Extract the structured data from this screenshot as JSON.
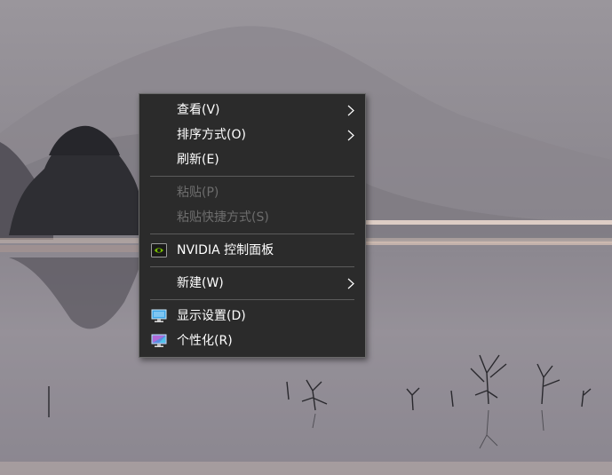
{
  "desktop": {
    "wallpaper": "misty-lake-wallpaper"
  },
  "context_menu": {
    "items": [
      {
        "label": "查看(V)",
        "submenu": true,
        "enabled": true
      },
      {
        "label": "排序方式(O)",
        "submenu": true,
        "enabled": true
      },
      {
        "label": "刷新(E)",
        "submenu": false,
        "enabled": true
      },
      {
        "label": "粘贴(P)",
        "submenu": false,
        "enabled": false
      },
      {
        "label": "粘贴快捷方式(S)",
        "submenu": false,
        "enabled": false
      },
      {
        "label": "NVIDIA 控制面板",
        "submenu": false,
        "enabled": true,
        "icon": "nvidia-icon"
      },
      {
        "label": "新建(W)",
        "submenu": true,
        "enabled": true
      },
      {
        "label": "显示设置(D)",
        "submenu": false,
        "enabled": true,
        "icon": "display-settings-icon"
      },
      {
        "label": "个性化(R)",
        "submenu": false,
        "enabled": true,
        "icon": "personalize-icon"
      }
    ],
    "colors": {
      "background": "#2b2b2b",
      "text": "#ffffff",
      "disabled_text": "#6d6d6d",
      "separator": "#5c5c5c",
      "nvidia_green": "#76b900"
    }
  }
}
